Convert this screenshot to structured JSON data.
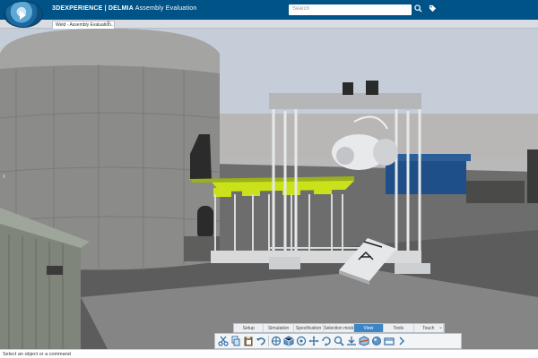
{
  "header": {
    "brand_bold": "3DEXPERIENCE | DELMIA",
    "brand_rest": " Assembly Evaluation",
    "search_placeholder": "Search"
  },
  "tabs": [
    {
      "label": "Weld - Assembly Evaluation..."
    }
  ],
  "tab_close": "×",
  "side_arrow": "›",
  "action_bar": {
    "tabs": [
      {
        "label": "Setup"
      },
      {
        "label": "Simulation"
      },
      {
        "label": "Specification"
      },
      {
        "label": "Selection mode"
      },
      {
        "label": "View"
      },
      {
        "label": "Tools"
      },
      {
        "label": "Touch"
      }
    ],
    "active_index": 4,
    "collapse": "⌄"
  },
  "toolbar": {
    "icons": [
      "scissors-icon",
      "copy-icon",
      "paste-icon",
      "undo-icon",
      "compass-icon",
      "cube-view-icon",
      "fit-all-icon",
      "pan-icon",
      "rotate-icon",
      "zoom-icon",
      "normal-view-icon",
      "clipping-icon",
      "render-style-icon",
      "camera-icon",
      "more-icon"
    ]
  },
  "status": {
    "text": "Select an object or a command"
  },
  "colors": {
    "brand_blue": "#005386",
    "accent_yellow": "#c9e21a",
    "sky": "#c3ccd7"
  }
}
